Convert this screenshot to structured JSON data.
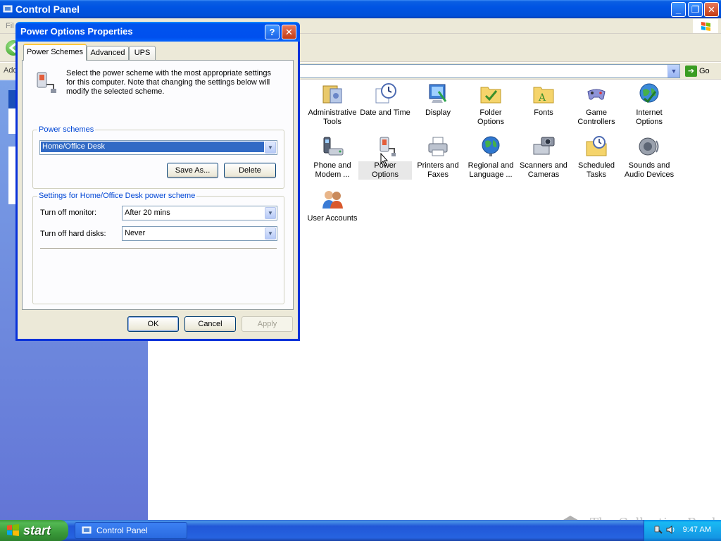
{
  "window": {
    "title": "Control Panel",
    "menubar_visible": "Fil",
    "address_label": "Add",
    "go_label": "Go"
  },
  "control_panel_items": [
    {
      "label": "Administrative Tools",
      "icon": "administrative-tools-icon"
    },
    {
      "label": "Date and Time",
      "icon": "date-time-icon"
    },
    {
      "label": "Display",
      "icon": "display-icon"
    },
    {
      "label": "Folder Options",
      "icon": "folder-options-icon"
    },
    {
      "label": "Fonts",
      "icon": "fonts-icon"
    },
    {
      "label": "Game Controllers",
      "icon": "game-controllers-icon"
    },
    {
      "label": "Internet Options",
      "icon": "internet-options-icon"
    },
    {
      "label": "Phone and Modem ...",
      "icon": "phone-modem-icon"
    },
    {
      "label": "Power Options",
      "icon": "power-options-icon"
    },
    {
      "label": "Printers and Faxes",
      "icon": "printers-faxes-icon"
    },
    {
      "label": "Regional and Language ...",
      "icon": "regional-language-icon"
    },
    {
      "label": "Scanners and Cameras",
      "icon": "scanners-cameras-icon"
    },
    {
      "label": "Scheduled Tasks",
      "icon": "scheduled-tasks-icon"
    },
    {
      "label": "Sounds and Audio Devices",
      "icon": "sounds-audio-icon"
    },
    {
      "label": "User Accounts",
      "icon": "user-accounts-icon"
    }
  ],
  "dialog": {
    "title": "Power Options Properties",
    "tabs": [
      "Power Schemes",
      "Advanced",
      "UPS"
    ],
    "active_tab": "Power Schemes",
    "intro": "Select the power scheme with the most appropriate settings for this computer. Note that changing the settings below will modify the selected scheme.",
    "schemes_group": "Power schemes",
    "scheme_value": "Home/Office Desk",
    "save_as": "Save As...",
    "delete": "Delete",
    "settings_group": "Settings for Home/Office Desk power scheme",
    "monitor_label": "Turn off monitor:",
    "monitor_value": "After 20 mins",
    "disks_label": "Turn off hard disks:",
    "disks_value": "Never",
    "ok": "OK",
    "cancel": "Cancel",
    "apply": "Apply"
  },
  "taskbar": {
    "start_label": "start",
    "task_label": "Control Panel",
    "clock": "9:47 AM"
  },
  "watermark": "The Collection Book",
  "colors": {
    "xp_blue_title": "#0054e3",
    "task_pane": "#6f8ce0",
    "dialog_face": "#ece9d8",
    "selection": "#316ac5",
    "group_label": "#0046d5",
    "start_green": "#3a9a3a"
  }
}
